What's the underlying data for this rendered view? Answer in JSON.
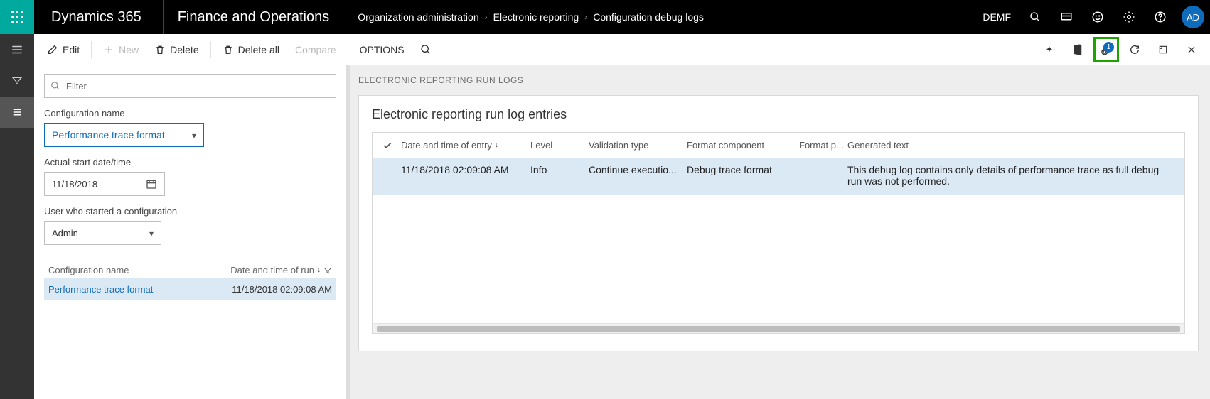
{
  "top": {
    "brand": "Dynamics 365",
    "module": "Finance and Operations",
    "breadcrumb": [
      "Organization administration",
      "Electronic reporting",
      "Configuration debug logs"
    ],
    "legal_entity": "DEMF",
    "avatar": "AD"
  },
  "toolbar": {
    "edit": "Edit",
    "new": "New",
    "delete": "Delete",
    "delete_all": "Delete all",
    "compare": "Compare",
    "options": "OPTIONS",
    "attach_badge": "1"
  },
  "filter": {
    "placeholder": "Filter",
    "config_label": "Configuration name",
    "config_value": "Performance trace format",
    "date_label": "Actual start date/time",
    "date_value": "11/18/2018",
    "user_label": "User who started a configuration",
    "user_value": "Admin"
  },
  "list": {
    "col1": "Configuration name",
    "col2": "Date and time of run",
    "row": {
      "name": "Performance trace format",
      "time": "11/18/2018 02:09:08 AM"
    }
  },
  "right": {
    "section": "ELECTRONIC REPORTING RUN LOGS",
    "card_title": "Electronic reporting run log entries",
    "columns": {
      "date": "Date and time of entry",
      "level": "Level",
      "vtype": "Validation type",
      "fmt": "Format component",
      "fmtp": "Format p...",
      "gen": "Generated text"
    },
    "row": {
      "date": "11/18/2018 02:09:08 AM",
      "level": "Info",
      "vtype": "Continue executio...",
      "fmt": "Debug trace format",
      "fmtp": "",
      "gen": "This debug log contains only details of performance trace as full debug run was not performed."
    }
  }
}
